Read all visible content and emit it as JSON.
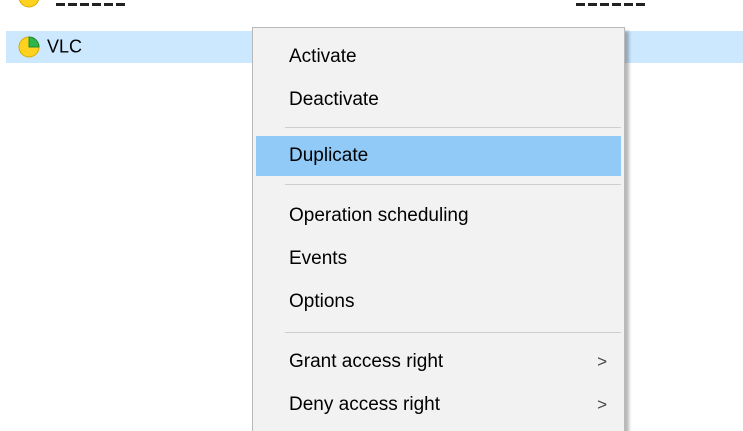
{
  "list": {
    "rows": [
      {
        "name": "VLC",
        "selected": true,
        "icon": "status-pie-icon"
      }
    ],
    "previous_row": {
      "icon": "status-icon",
      "partially_visible": true
    }
  },
  "context_menu": {
    "groups": [
      [
        {
          "label": "Activate",
          "submenu": false,
          "highlighted": false
        },
        {
          "label": "Deactivate",
          "submenu": false,
          "highlighted": false
        }
      ],
      [
        {
          "label": "Duplicate",
          "submenu": false,
          "highlighted": true
        }
      ],
      [
        {
          "label": "Operation scheduling",
          "submenu": false,
          "highlighted": false
        },
        {
          "label": "Events",
          "submenu": false,
          "highlighted": false
        },
        {
          "label": "Options",
          "submenu": false,
          "highlighted": false
        }
      ],
      [
        {
          "label": "Grant access right",
          "submenu": true,
          "highlighted": false
        },
        {
          "label": "Deny access right",
          "submenu": true,
          "highlighted": false
        }
      ]
    ],
    "submenu_arrow": ">"
  },
  "colors": {
    "selection_row": "#cce8ff",
    "menu_highlight": "#91c9f7",
    "menu_background": "#f2f2f2",
    "icon_yellow": "#ffd21f",
    "icon_green": "#2fb54a"
  }
}
